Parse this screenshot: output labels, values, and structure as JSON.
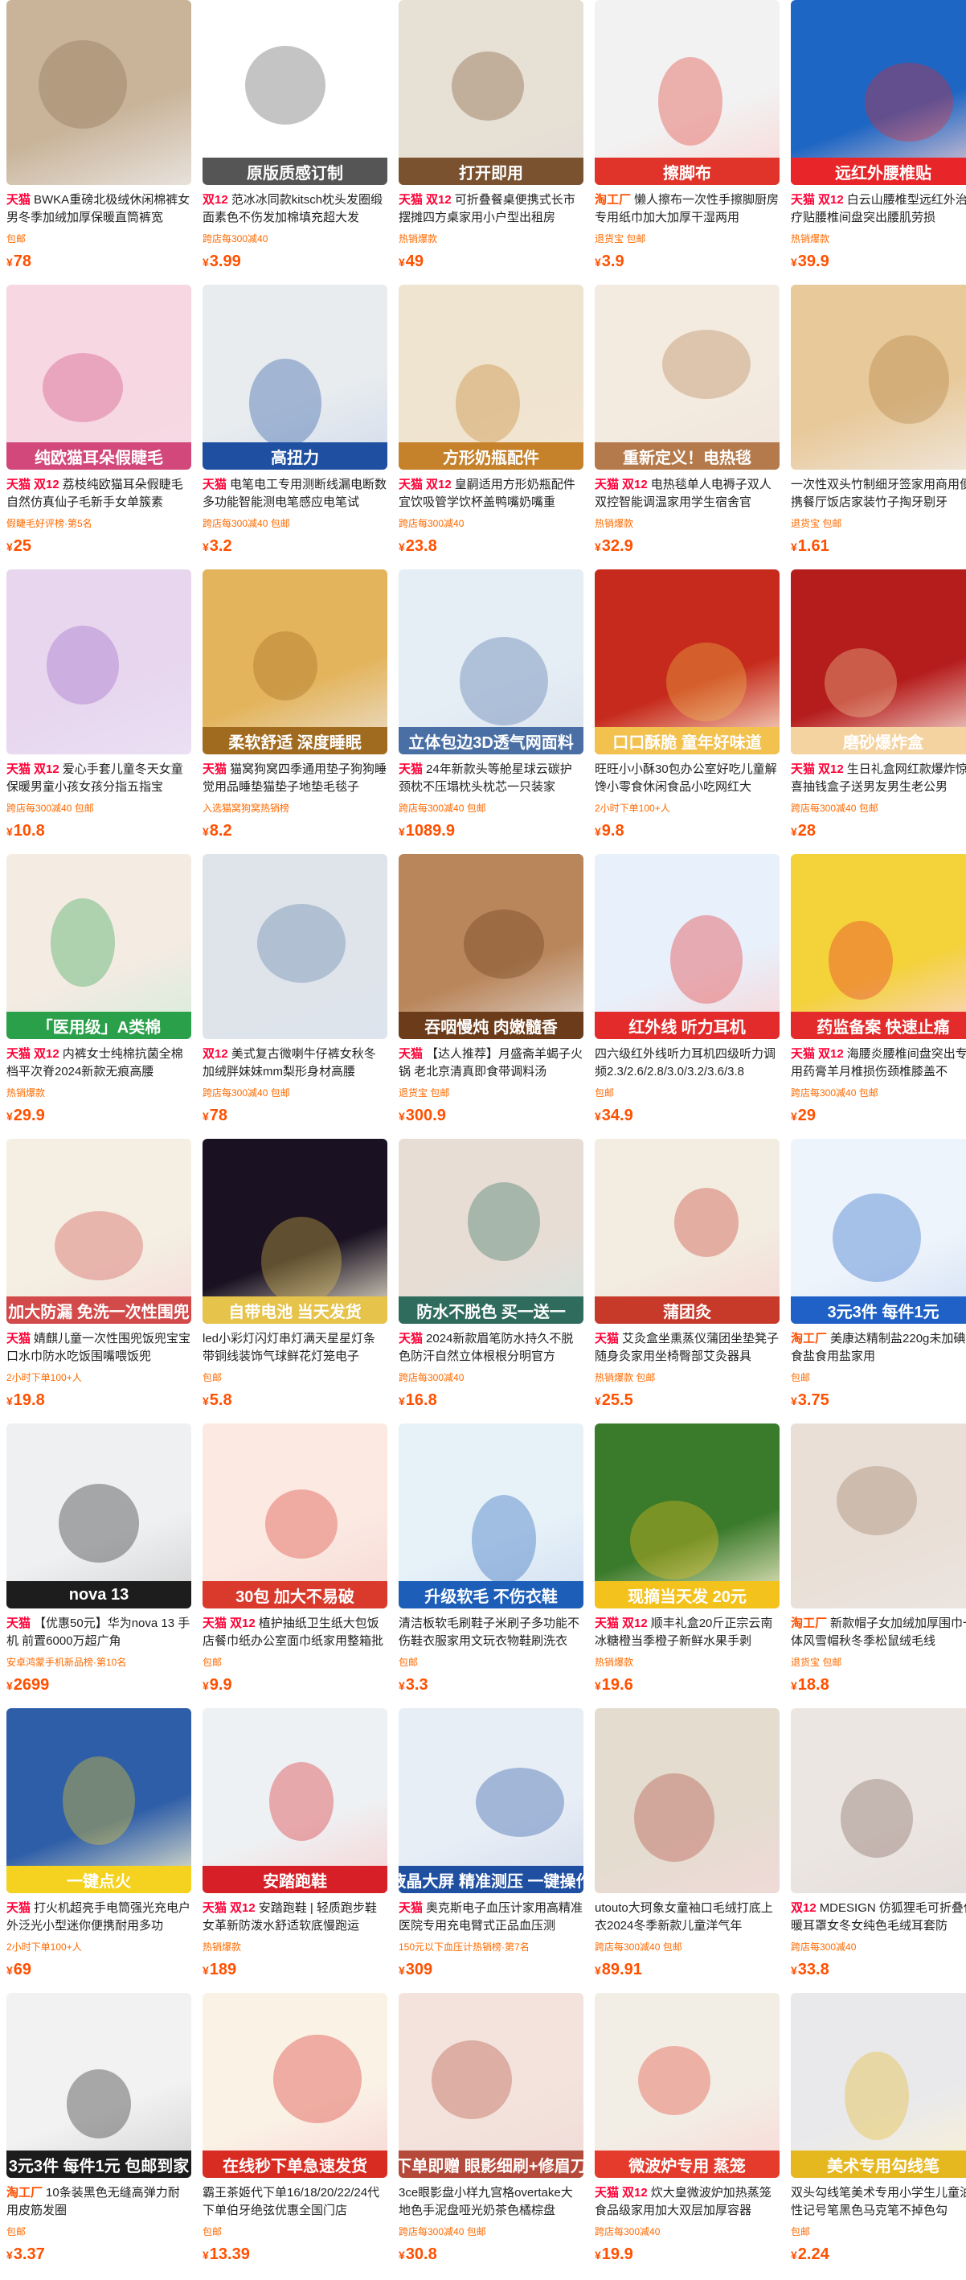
{
  "products": [
    {
      "img_caption": "",
      "tags": [
        "天猫"
      ],
      "title": "BWKA重磅北极绒休闲棉裤女男冬季加绒加厚保暖直筒裤宽",
      "meta": "包邮",
      "price": "78",
      "bg": "#c9b49a",
      "accent": "#8a6c4e"
    },
    {
      "img_caption": "原版质感订制",
      "tags": [
        "双12"
      ],
      "title": "范冰冰同款kitsch枕头发圈缎面素色不伤发加棉填充超大发",
      "meta": "跨店每300减40",
      "price": "3.99",
      "bg": "#e9e4df",
      "accent": "#555"
    },
    {
      "img_caption": "打开即用",
      "tags": [
        "天猫",
        "双12"
      ],
      "title": "可折叠餐桌便携式长市摆摊四方桌家用小户型出租房",
      "meta": "热销爆款",
      "price": "49",
      "bg": "#e7e1d5",
      "accent": "#7a5230"
    },
    {
      "img_caption": "擦脚布",
      "tags": [
        "淘工厂"
      ],
      "title": "懒人擦布一次性手擦脚厨房专用纸巾加大加厚干湿两用",
      "meta": "退货宝 包邮",
      "price": "3.9",
      "bg": "#f2f2f2",
      "accent": "#e0342b"
    },
    {
      "img_caption": "远红外腰椎贴",
      "tags": [
        "天猫",
        "双12"
      ],
      "title": "白云山腰椎型远红外治疗贴腰椎间盘突出腰肌劳损",
      "meta": "热销爆款",
      "price": "39.9",
      "bg": "#1d66c4",
      "accent": "#e8262a"
    },
    {
      "img_caption": "纯欧猫耳朵假睫毛",
      "tags": [
        "天猫",
        "双12"
      ],
      "title": "荔枝纯欧猫耳朵假睫毛自然仿真仙子毛新手女单簇素",
      "meta": "假睫毛好评榜·第5名",
      "price": "25",
      "bg": "#f6d7e2",
      "accent": "#d2487a"
    },
    {
      "img_caption": "高扭力",
      "tags": [
        "天猫"
      ],
      "title": "电笔电工专用测断线漏电断数多功能智能测电笔感应电笔试",
      "meta": "跨店每300减40 包邮",
      "price": "3.2",
      "bg": "#e8ecef",
      "accent": "#1f4fa0"
    },
    {
      "img_caption": "方形奶瓶配件",
      "tags": [
        "天猫",
        "双12"
      ],
      "title": "皇嗣适用方形奶瓶配件宜饮吸管学饮杯盖鸭嘴奶嘴重",
      "meta": "跨店每300减40",
      "price": "23.8",
      "bg": "#efe4cf",
      "accent": "#c5822b"
    },
    {
      "img_caption": "重新定义！电热毯",
      "tags": [
        "天猫",
        "双12"
      ],
      "title": "电热毯单人电褥子双人双控智能调温家用学生宿舍官",
      "meta": "热销爆款",
      "price": "32.9",
      "bg": "#f3ebe0",
      "accent": "#b57a4b"
    },
    {
      "img_caption": "",
      "tags": [],
      "title": "一次性双头竹制细牙签家用商用便携餐厅饭店家装竹子掏牙剔牙",
      "meta": "退货宝 包邮",
      "price": "1.61",
      "bg": "#e8c99a",
      "accent": "#b07b3a"
    },
    {
      "img_caption": "",
      "tags": [
        "天猫",
        "双12"
      ],
      "title": "爱心手套儿童冬天女童保暖男童小孩女孩分指五指宝",
      "meta": "跨店每300减40 包邮",
      "price": "10.8",
      "bg": "#e7d6ee",
      "accent": "#9a63c7"
    },
    {
      "img_caption": "柔软舒适 深度睡眠",
      "tags": [
        "天猫"
      ],
      "title": "猫窝狗窝四季通用垫子狗狗睡觉用品睡垫猫垫子地垫毛毯子",
      "meta": "入选猫窝狗窝热销榜",
      "price": "8.2",
      "bg": "#e3b45c",
      "accent": "#a06a1f"
    },
    {
      "img_caption": "立体包边3D透气网面料",
      "tags": [
        "天猫"
      ],
      "title": "24年新款头等舱星球云碳护颈枕不压塌枕头枕芯一只装家",
      "meta": "跨店每300减40 包邮",
      "price": "1089.9",
      "bg": "#e5edf5",
      "accent": "#4a6fa5"
    },
    {
      "img_caption": "口口酥脆 童年好味道",
      "tags": [],
      "title": "旺旺小小酥30包办公室好吃儿童解馋小零食休闲食品小吃网红大",
      "meta": "2小时下单100+人",
      "price": "9.8",
      "bg": "#c62a1c",
      "accent": "#f2c14e"
    },
    {
      "img_caption": "磨砂爆炸盒",
      "tags": [
        "天猫",
        "双12"
      ],
      "title": "生日礼盒网红款爆炸惊喜抽钱盒子送男友男生老公男",
      "meta": "跨店每300减40 包邮",
      "price": "28",
      "bg": "#b51d1d",
      "accent": "#f5d3a0"
    },
    {
      "img_caption": "「医用级」A类棉",
      "tags": [
        "天猫",
        "双12"
      ],
      "title": "内裤女士纯棉抗菌全棉档平次脊2024新款无痕高腰",
      "meta": "热销爆款",
      "price": "29.9",
      "bg": "#f4ebe3",
      "accent": "#2aa04a"
    },
    {
      "img_caption": "",
      "tags": [
        "双12"
      ],
      "title": "美式复古微喇牛仔裤女秋冬加绒胖妹妹mm梨形身材高腰",
      "meta": "跨店每300减40 包邮",
      "price": "78",
      "bg": "#dfe4ea",
      "accent": "#5a7aa6"
    },
    {
      "img_caption": "吞咽慢炖 肉嫩髓香",
      "tags": [
        "天猫"
      ],
      "title": "【达人推荐】月盛斋羊蝎子火锅 老北京清真即食带调料汤",
      "meta": "退货宝 包邮",
      "price": "300.9",
      "bg": "#b9855a",
      "accent": "#6b3b1a"
    },
    {
      "img_caption": "红外线 听力耳机",
      "tags": [],
      "title": "四六级红外线听力耳机四级听力调频2.3/2.6/2.8/3.0/3.2/3.6/3.8",
      "meta": "包邮",
      "price": "34.9",
      "bg": "#e8f0fb",
      "accent": "#e32b2b"
    },
    {
      "img_caption": "药监备案 快速止痛",
      "tags": [
        "天猫",
        "双12"
      ],
      "title": "海腰炎腰椎间盘突出专用药膏羊月椎损伤颈椎膝盖不",
      "meta": "跨店每300减40 包邮",
      "price": "29",
      "bg": "#f4d23a",
      "accent": "#e32b2b"
    },
    {
      "img_caption": "加大防漏 免洗一次性围兜",
      "tags": [
        "天猫"
      ],
      "title": "婧麒儿童一次性围兜饭兜宝宝口水巾防水吃饭围嘴喂饭兜",
      "meta": "2小时下单100+人",
      "price": "19.8",
      "bg": "#f4efe2",
      "accent": "#d24a4a"
    },
    {
      "img_caption": "自带电池 当天发货",
      "tags": [],
      "title": "led小彩灯闪灯串灯满天星星灯条带铜线装饰气球鲜花灯笼电子",
      "meta": "包邮",
      "price": "5.8",
      "bg": "#1a1222",
      "accent": "#e6c34a"
    },
    {
      "img_caption": "防水不脱色 买一送一",
      "tags": [
        "天猫"
      ],
      "title": "2024新款眉笔防水持久不脱色防汗自然立体根根分明官方",
      "meta": "跨店每300减40",
      "price": "16.8",
      "bg": "#e8ddd4",
      "accent": "#2f6c5e"
    },
    {
      "img_caption": "蒲团灸",
      "tags": [
        "天猫"
      ],
      "title": "艾灸盒坐熏蒸仪蒲团坐垫凳子随身灸家用坐椅臀部艾灸器具",
      "meta": "热销爆款 包邮",
      "price": "25.5",
      "bg": "#f3ece0",
      "accent": "#c73a2a"
    },
    {
      "img_caption": "3元3件 每件1元",
      "tags": [
        "淘工厂"
      ],
      "title": "美康达精制盐220g未加碘食盐食用盐家用",
      "meta": "包邮",
      "price": "3.75",
      "bg": "#eef4fb",
      "accent": "#1f61c6"
    },
    {
      "img_caption": "nova 13",
      "tags": [
        "天猫"
      ],
      "title": "【优惠50元】华为nova 13 手机 前置6000万超广角",
      "meta": "安卓鸿蒙手机新品榜·第10名",
      "price": "2699",
      "bg": "#eef0f2",
      "accent": "#1d1d1d"
    },
    {
      "img_caption": "30包 加大不易破",
      "tags": [
        "天猫",
        "双12"
      ],
      "title": "植护抽纸卫生纸大包饭店餐巾纸办公室面巾纸家用整箱批实",
      "meta": "包邮",
      "price": "9.9",
      "bg": "#fbe9e2",
      "accent": "#d93a2c"
    },
    {
      "img_caption": "升级软毛 不伤衣鞋",
      "tags": [],
      "title": "清洁板软毛刷鞋子米刷子多功能不伤鞋衣服家用文玩衣物鞋刷洗衣",
      "meta": "包邮",
      "price": "3.3",
      "bg": "#e6f1f8",
      "accent": "#1d5fb8"
    },
    {
      "img_caption": "现摘当天发 20元",
      "tags": [
        "天猫",
        "双12"
      ],
      "title": "顺丰礼盒20斤正宗云南冰糖橙当季橙子新鲜水果手剥",
      "meta": "热销爆款",
      "price": "19.6",
      "bg": "#3a7a2b",
      "accent": "#f4c21c"
    },
    {
      "img_caption": "",
      "tags": [
        "淘工厂"
      ],
      "title": "新款帽子女加绒加厚围巾一体风雪帽秋冬季松鼠绒毛线",
      "meta": "退货宝 包邮",
      "price": "18.8",
      "bg": "#e9dfd6",
      "accent": "#9a7a63"
    },
    {
      "img_caption": "一键点火",
      "tags": [
        "天猫"
      ],
      "title": "打火机超亮手电筒强光充电户外泛光小型迷你便携耐用多功",
      "meta": "2小时下单100+人",
      "price": "69",
      "bg": "#2f5ea8",
      "accent": "#f4d21f"
    },
    {
      "img_caption": "安踏跑鞋",
      "tags": [
        "天猫",
        "双12"
      ],
      "title": "安踏跑鞋 | 轻质跑步鞋女革新防泼水舒适软底慢跑运",
      "meta": "热销爆款",
      "price": "189",
      "bg": "#eef1f3",
      "accent": "#d61f26"
    },
    {
      "img_caption": "液晶大屏 精准测压 一键操作",
      "tags": [
        "天猫"
      ],
      "title": "奥克斯电子血压计家用高精准医院专用充电臂式正品血压测",
      "meta": "150元以下血压计热销榜·第7名",
      "price": "309",
      "bg": "#e8eef6",
      "accent": "#1f4fa0"
    },
    {
      "img_caption": "",
      "tags": [],
      "title": "utouto大珂象女童袖口毛绒打底上衣2024冬季新款儿童洋气年",
      "meta": "跨店每300减40 包邮",
      "price": "89.91",
      "bg": "#e3dccf",
      "accent": "#b1453a"
    },
    {
      "img_caption": "",
      "tags": [
        "双12"
      ],
      "title": "MDESIGN 仿狐狸毛可折叠保暖耳罩女冬女纯色毛绒耳套防",
      "meta": "跨店每300减40",
      "price": "33.8",
      "bg": "#ece6e2",
      "accent": "#7b5c52"
    },
    {
      "img_caption": "3元3件 每件1元 包邮到家",
      "tags": [
        "淘工厂"
      ],
      "title": "10条装黑色无缝高弹力耐用皮筋发圈",
      "meta": "包邮",
      "price": "3.37",
      "bg": "#f2f2f2",
      "accent": "#1c1c1c"
    },
    {
      "img_caption": "在线秒下单急速发货",
      "tags": [],
      "title": "霸王茶姬代下单16/18/20/22/24代下单伯牙绝弦优惠全国门店",
      "meta": "包邮",
      "price": "13.39",
      "bg": "#fbf2e6",
      "accent": "#d82b22"
    },
    {
      "img_caption": "下单即赠 眼影细刷+修眉刀",
      "tags": [],
      "title": "3ce眼影盘小样九宫格overtake大地色手泥盘哑光奶茶色橘棕盘",
      "meta": "跨店每300减40 包邮",
      "price": "30.8",
      "bg": "#f3e3dc",
      "accent": "#b54a3a"
    },
    {
      "img_caption": "微波炉专用 蒸笼",
      "tags": [
        "天猫",
        "双12"
      ],
      "title": "炊大皇微波炉加热蒸笼食品级家用加大双层加厚容器",
      "meta": "跨店每300减40",
      "price": "19.9",
      "bg": "#f2eee6",
      "accent": "#e43b2c"
    },
    {
      "img_caption": "美术专用勾线笔",
      "tags": [],
      "title": "双头勾线笔美术专用小学生儿童油性记号笔黑色马克笔不掉色勾",
      "meta": "包邮",
      "price": "2.24",
      "bg": "#e9e9ec",
      "accent": "#e6b81f"
    }
  ]
}
